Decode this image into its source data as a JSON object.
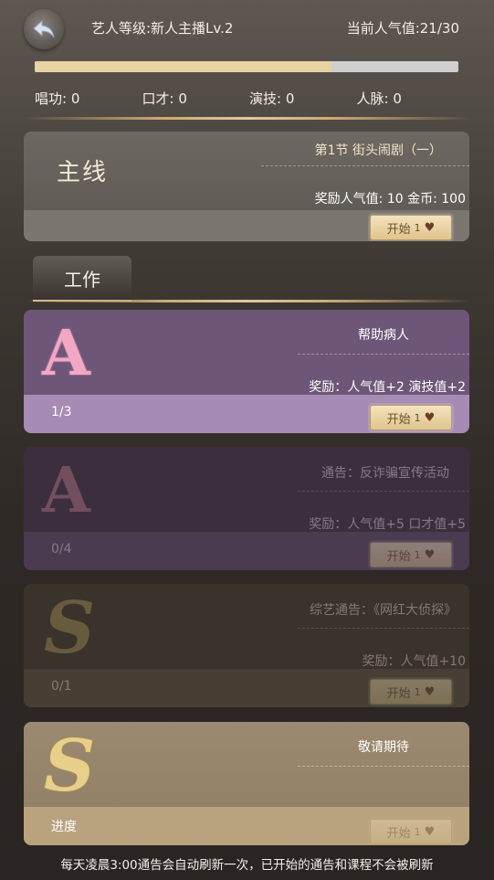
{
  "header": {
    "level_text": "艺人等级:新人主播Lv.2",
    "popularity_text": "当前人气值:21/30",
    "popularity_progress": 0.7
  },
  "stats": [
    {
      "label": "唱功: 0"
    },
    {
      "label": "口才: 0"
    },
    {
      "label": "演技: 0"
    },
    {
      "label": "人脉: 0"
    }
  ],
  "main_quest": {
    "tag": "主线",
    "title": "第1节 街头闹剧（一）",
    "reward": "奖励人气值: 10  金币: 100",
    "start_label": "开始",
    "start_cost": "1"
  },
  "tab": {
    "label": "工作"
  },
  "jobs": [
    {
      "grade": "A",
      "title": "帮助病人",
      "reward": "奖励：人气值+2  演技值+2",
      "count": "1/3",
      "start_label": "开始",
      "start_cost": "1"
    },
    {
      "grade": "A",
      "title": "通告：反诈骗宣传活动",
      "reward": "奖励：人气值+5  口才值+5",
      "count": "0/4",
      "start_label": "开始",
      "start_cost": "1"
    },
    {
      "grade": "S",
      "title": "综艺通告：《网红大侦探》",
      "reward": "奖励：人气值+10",
      "count": "0/1",
      "start_label": "开始",
      "start_cost": "1"
    },
    {
      "grade": "S",
      "title": "敬请期待",
      "reward": "",
      "count": "进度",
      "start_label": "开始",
      "start_cost": "1"
    }
  ],
  "footer": {
    "note": "每天凌晨3:00通告会自动刷新一次，已开始的通告和课程不会被刷新"
  },
  "colors": {
    "accent_gold": "#e7d3a3",
    "purple_card": "#6e5678",
    "purple_band": "#a48ab2"
  }
}
